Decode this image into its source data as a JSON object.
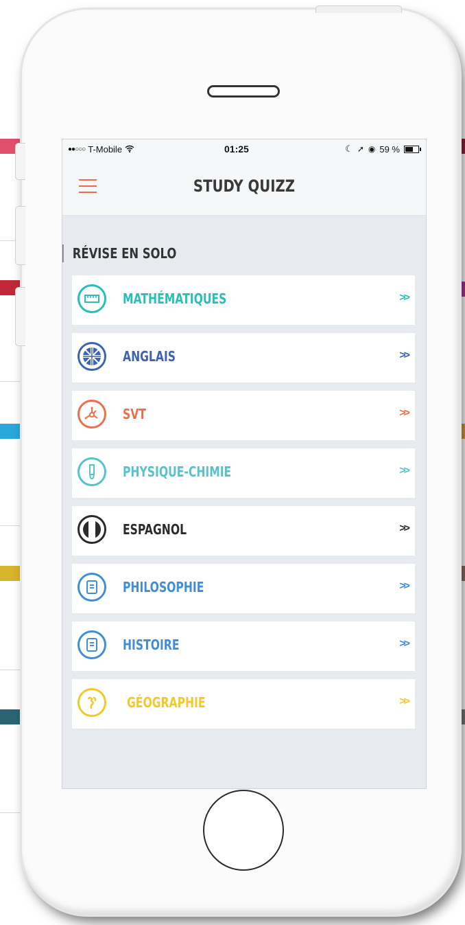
{
  "status_bar": {
    "carrier": "T-Mobile",
    "time": "01:25",
    "battery": "59 %",
    "battery_level": 0.59
  },
  "header": {
    "title": "STUDY QUIZZ",
    "menu_icon": "hamburger-icon"
  },
  "section": {
    "title": "RÉVISE EN SOLO"
  },
  "subjects": [
    {
      "label": "MATHÉMATIQUES",
      "icon": "ruler-icon",
      "color": "#26c1b6",
      "arrow": ">>"
    },
    {
      "label": "ANGLAIS",
      "icon": "union-jack-flag-icon",
      "color": "#3d63b3",
      "arrow": ">>"
    },
    {
      "label": "SVT",
      "icon": "molecule-icon",
      "color": "#ef6e4a",
      "arrow": ">>"
    },
    {
      "label": "PHYSIQUE-CHIMIE",
      "icon": "flask-icon",
      "color": "#56c3c9",
      "arrow": ">>"
    },
    {
      "label": "ESPAGNOL",
      "icon": "flag-icon",
      "color": "#2b2b2b",
      "arrow": ">>"
    },
    {
      "label": "PHILOSOPHIE",
      "icon": "book-icon",
      "color": "#3f8fd8",
      "arrow": ">>"
    },
    {
      "label": "HISTOIRE",
      "icon": "book-icon",
      "color": "#3f8fd8",
      "arrow": ">>"
    },
    {
      "label": "GÉOGRAPHIE",
      "icon": "globe-icon",
      "color": "#f3c92a",
      "arrow": ">>"
    }
  ]
}
